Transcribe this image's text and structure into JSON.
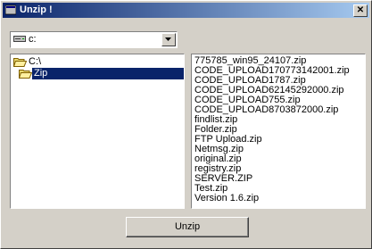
{
  "window": {
    "title": "Unzip !",
    "close_label": "✕"
  },
  "drive": {
    "selected": "c:",
    "icon": "drive-icon"
  },
  "directories": [
    {
      "label": "C:\\",
      "icon": "folder-open-icon",
      "selected": false
    },
    {
      "label": "Zip",
      "icon": "folder-open-icon",
      "selected": true
    }
  ],
  "files": [
    "775785_win95_24107.zip",
    "CODE_UPLOAD170773142001.zip",
    "CODE_UPLOAD1787.zip",
    "CODE_UPLOAD62145292000.zip",
    "CODE_UPLOAD755.zip",
    "CODE_UPLOAD8703872000.zip",
    "findlist.zip",
    "Folder.zip",
    "FTP Upload.zip",
    "Netmsg.zip",
    "original.zip",
    "registry.zip",
    "SERVER.ZIP",
    "Test.zip",
    "Version 1.6.zip"
  ],
  "actions": {
    "unzip_label": "Unzip"
  }
}
